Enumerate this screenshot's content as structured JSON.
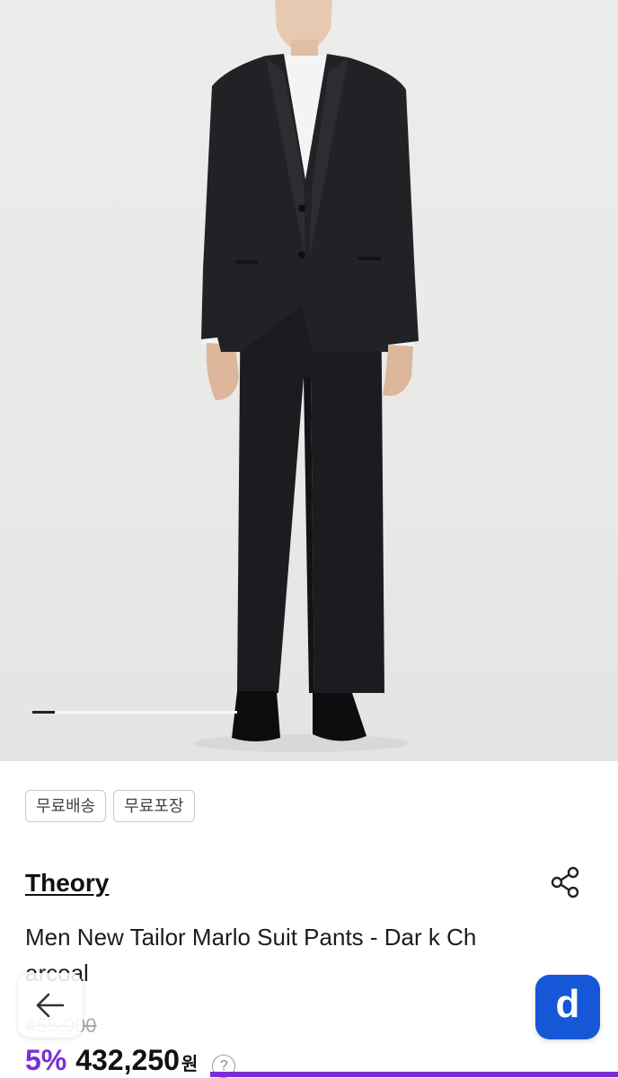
{
  "hero": {
    "image_alt": "",
    "carousel_progress": 0.11
  },
  "tags": [
    "무료배송",
    "무료포장"
  ],
  "product": {
    "brand": "Theory",
    "title": "Men New Tailor Marlo Suit Pants - Dar k Charcoal",
    "original_price": "455,000",
    "discount": "5%",
    "sale_price": "432,250",
    "currency": "원",
    "help": "?"
  },
  "app_button": {
    "label": "d"
  },
  "colors": {
    "accent": "#7a2fd6",
    "app_button": "#1657d8",
    "suit": "#1e1e22"
  }
}
